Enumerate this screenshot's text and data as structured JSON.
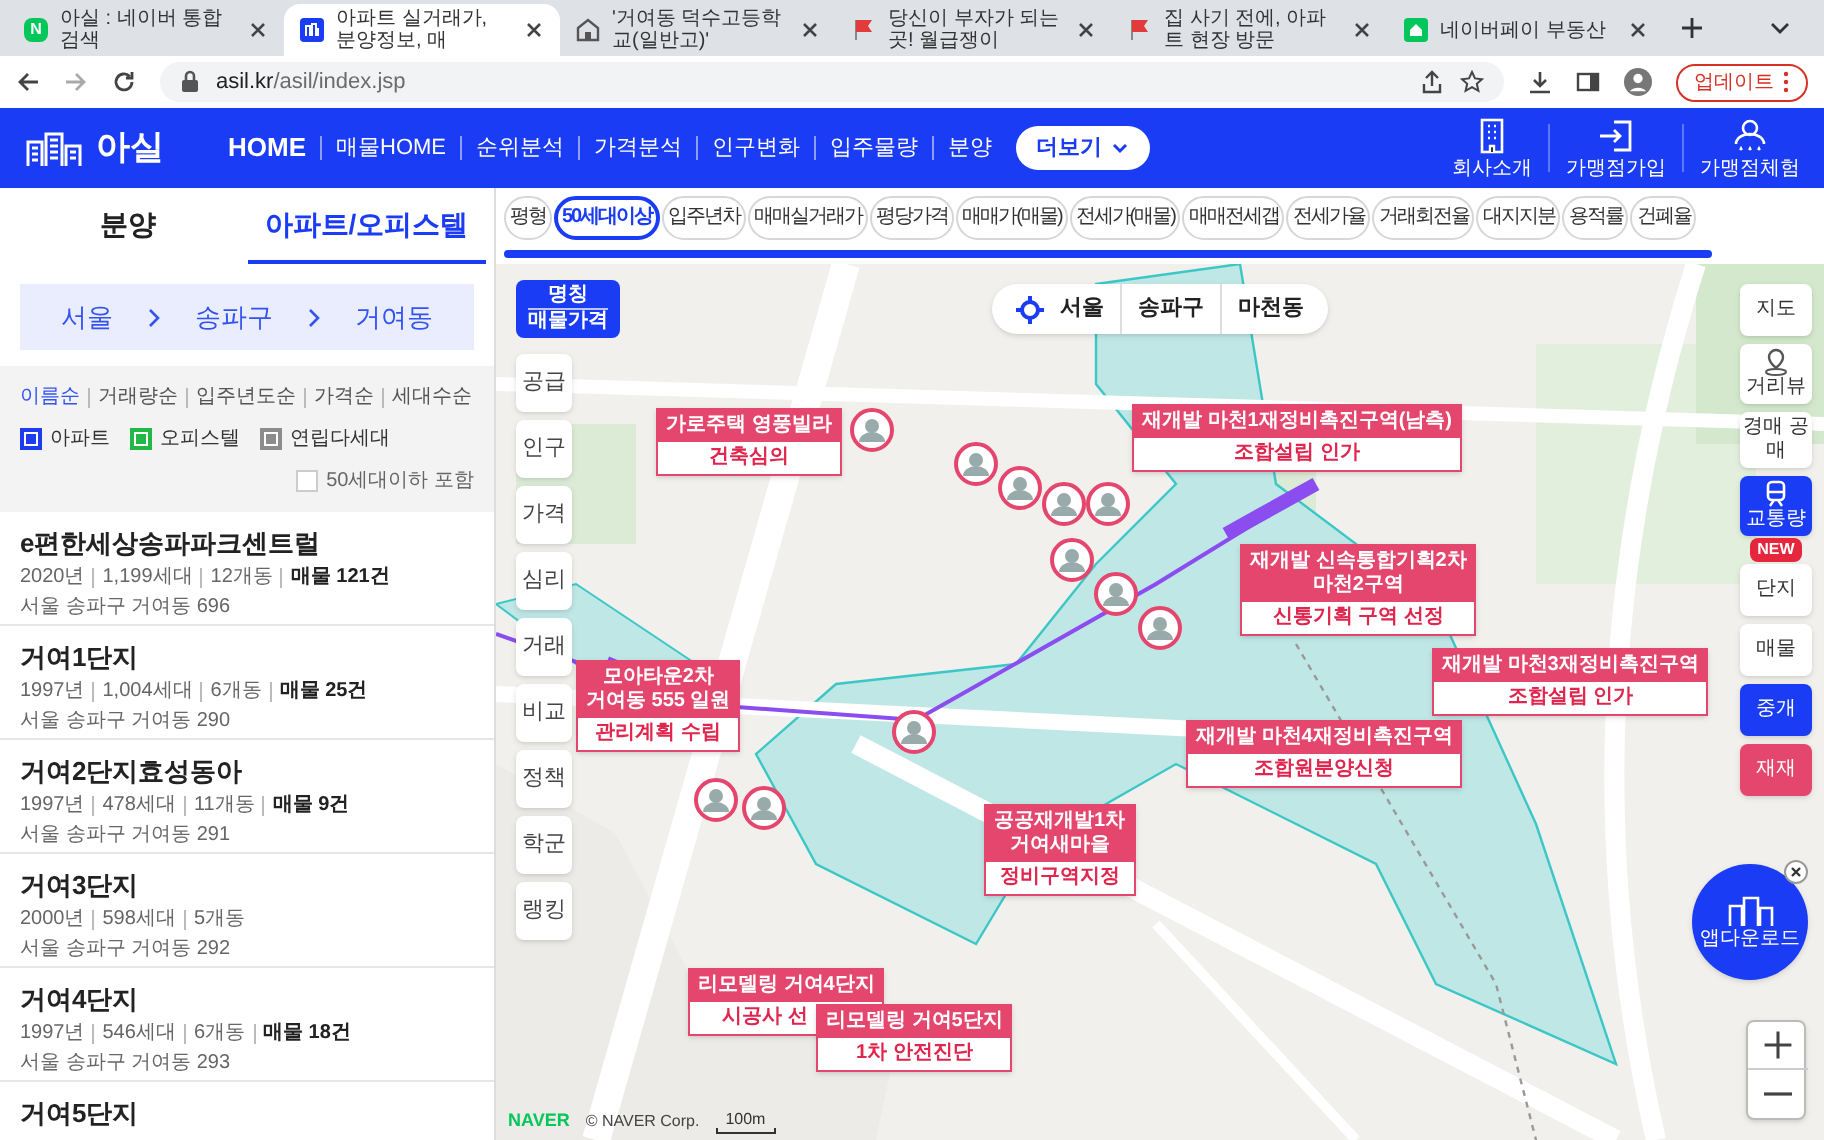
{
  "browser": {
    "tabs": [
      {
        "kind": "naver",
        "badge": "N",
        "title": "아실 : 네이버 통합검색",
        "selected": false
      },
      {
        "kind": "asil",
        "title": "아파트 실거래가, 분양정보, 매",
        "selected": true
      },
      {
        "kind": "school",
        "title": "'거여동 덕수고등학교(일반고)'",
        "selected": false
      },
      {
        "kind": "flag",
        "title": "당신이 부자가 되는 곳! 월급쟁이",
        "selected": false
      },
      {
        "kind": "flag",
        "title": "집 사기 전에, 아파트 현장 방문",
        "selected": false
      },
      {
        "kind": "pay",
        "title": "네이버페이 부동산",
        "selected": false
      }
    ],
    "url": {
      "host": "asil.kr",
      "path": "/asil/index.jsp"
    },
    "update_button": "업데이트"
  },
  "header": {
    "logo": "아실",
    "nav": [
      {
        "label": "HOME",
        "selected": true
      },
      {
        "label": "매물HOME",
        "selected": false
      },
      {
        "label": "순위분석",
        "selected": false
      },
      {
        "label": "가격분석",
        "selected": false
      },
      {
        "label": "인구변화",
        "selected": false
      },
      {
        "label": "입주물량",
        "selected": false
      },
      {
        "label": "분양",
        "selected": false
      }
    ],
    "more_button": "더보기",
    "links": [
      {
        "kind": "building",
        "label": "회사소개"
      },
      {
        "kind": "join",
        "label": "가맹점가입"
      },
      {
        "kind": "trial",
        "label": "가맹점체험"
      }
    ]
  },
  "sidebar": {
    "tabs": [
      {
        "label": "분양",
        "selected": false
      },
      {
        "label": "아파트/오피스텔",
        "selected": true
      }
    ],
    "breadcrumb": [
      "서울",
      "송파구",
      "거여동"
    ],
    "sort_options": [
      {
        "label": "이름순",
        "selected": true
      },
      {
        "label": "거래량순",
        "selected": false
      },
      {
        "label": "입주년도순",
        "selected": false
      },
      {
        "label": "가격순",
        "selected": false
      },
      {
        "label": "세대수순",
        "selected": false
      }
    ],
    "type_filters": [
      {
        "label": "아파트",
        "checked": true,
        "color": "#1d3cf0"
      },
      {
        "label": "오피스텔",
        "checked": true,
        "color": "#22b845"
      },
      {
        "label": "연립다세대",
        "checked": true,
        "color": "#8c8c8c"
      }
    ],
    "small_filter": {
      "label": "50세대이하 포함",
      "checked": false
    },
    "complexes": [
      {
        "name": "e편한세상송파파크센트럴",
        "year": "2020년",
        "households": "1,199세대",
        "buildings": "12개동",
        "listings": "매물 121건",
        "address": "서울 송파구 거여동 696"
      },
      {
        "name": "거여1단지",
        "year": "1997년",
        "households": "1,004세대",
        "buildings": "6개동",
        "listings": "매물 25건",
        "address": "서울 송파구 거여동 290"
      },
      {
        "name": "거여2단지효성동아",
        "year": "1997년",
        "households": "478세대",
        "buildings": "11개동",
        "listings": "매물 9건",
        "address": "서울 송파구 거여동 291"
      },
      {
        "name": "거여3단지",
        "year": "2000년",
        "households": "598세대",
        "buildings": "5개동",
        "address": "서울 송파구 거여동 292"
      },
      {
        "name": "거여4단지",
        "year": "1997년",
        "households": "546세대",
        "buildings": "6개동",
        "listings": "매물 18건",
        "address": "서울 송파구 거여동 293"
      },
      {
        "name": "거여5단지"
      }
    ]
  },
  "map": {
    "filters": [
      {
        "label": "평형",
        "selected": false
      },
      {
        "label": "50세대이상",
        "selected": true
      },
      {
        "label": "입주년차",
        "selected": false
      },
      {
        "label": "매매실거래가",
        "selected": false
      },
      {
        "label": "평당가격",
        "selected": false
      },
      {
        "label": "매매가(매물)",
        "selected": false
      },
      {
        "label": "전세가(매물)",
        "selected": false
      },
      {
        "label": "매매전세갭",
        "selected": false
      },
      {
        "label": "전세가율",
        "selected": false
      },
      {
        "label": "거래회전율",
        "selected": false
      },
      {
        "label": "대지지분",
        "selected": false
      },
      {
        "label": "용적률",
        "selected": false
      },
      {
        "label": "건폐율",
        "selected": false
      }
    ],
    "legend": [
      "명칭",
      "매물가격"
    ],
    "location": [
      "서울",
      "송파구",
      "마천동"
    ],
    "left_buttons": [
      "공급",
      "인구",
      "가격",
      "심리",
      "거래",
      "비교",
      "정책",
      "학군",
      "랭킹"
    ],
    "right_buttons": [
      {
        "label": "지도",
        "kind": "plain"
      },
      {
        "label": "거리뷰",
        "kind": "streetview"
      },
      {
        "label": "경매 공매",
        "kind": "plain"
      },
      {
        "label": "교통량",
        "kind": "traffic",
        "badge": "NEW"
      },
      {
        "label": "단지",
        "kind": "plain"
      },
      {
        "label": "매물",
        "kind": "plain"
      },
      {
        "label": "중개",
        "kind": "primary"
      },
      {
        "label": "재재",
        "kind": "accent"
      }
    ],
    "app_download": "앱다운로드",
    "callouts": [
      {
        "title": [
          "가로주택 영풍빌라"
        ],
        "status": "건축심의"
      },
      {
        "title": [
          "재개발 마천1재정비촉진구역(남측)"
        ],
        "status": "조합설립 인가"
      },
      {
        "title": [
          "모아타운2차",
          "거여동 555 일원"
        ],
        "status": "관리계획 수립"
      },
      {
        "title": [
          "재개발 신속통합기획2차",
          "마천2구역"
        ],
        "status": "신통기획 구역 선정"
      },
      {
        "title": [
          "재개발 마천4재정비촉진구역"
        ],
        "status": "조합원분양신청"
      },
      {
        "title": [
          "재개발 마천3재정비촉진구역"
        ],
        "status": "조합설립 인가"
      },
      {
        "title": [
          "공공재개발1차",
          "거여새마을"
        ],
        "status": "정비구역지정"
      },
      {
        "title": [
          "리모델링 거여4단지"
        ],
        "status": "시공사 선"
      },
      {
        "title": [
          "리모델링 거여5단지"
        ],
        "status": "1차 안전진단"
      }
    ],
    "attribution": {
      "logo": "NAVER",
      "copyright": "© NAVER Corp.",
      "scale": "100m"
    }
  }
}
